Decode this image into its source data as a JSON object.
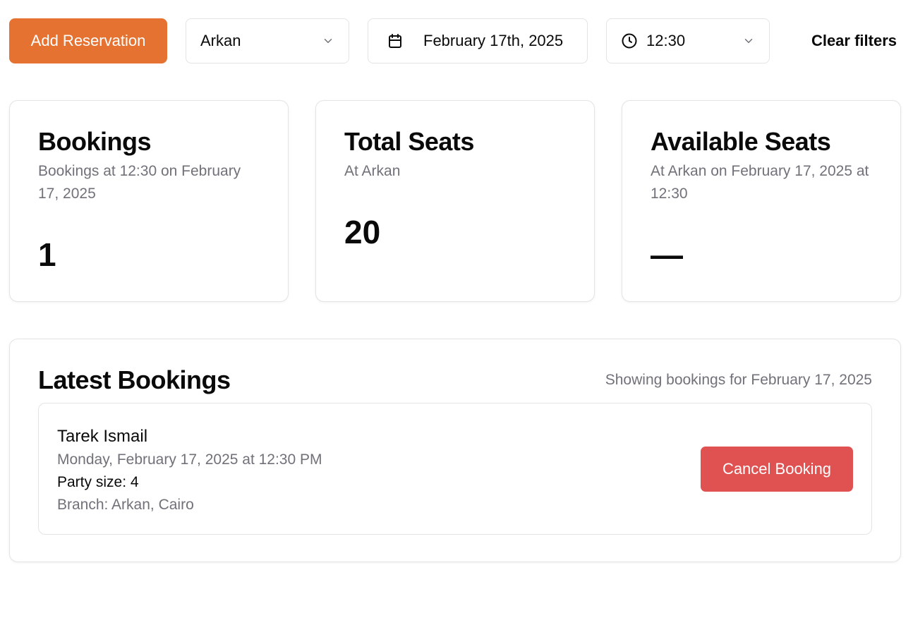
{
  "toolbar": {
    "add_reservation_label": "Add Reservation",
    "branch_value": "Arkan",
    "date_value": "February 17th, 2025",
    "time_value": "12:30",
    "clear_filters_label": "Clear filters"
  },
  "stats": {
    "bookings": {
      "title": "Bookings",
      "description": "Bookings at 12:30 on February 17, 2025",
      "value": "1"
    },
    "total_seats": {
      "title": "Total Seats",
      "description": "At Arkan",
      "value": "20"
    },
    "available_seats": {
      "title": "Available Seats",
      "description": "At Arkan on February 17, 2025 at 12:30",
      "value": "—"
    }
  },
  "latest": {
    "title": "Latest Bookings",
    "subtitle": "Showing bookings for February 17, 2025",
    "bookings": [
      {
        "name": "Tarek Ismail",
        "datetime": "Monday, February 17, 2025 at 12:30 PM",
        "party_size": "Party size: 4",
        "branch": "Branch: Arkan, Cairo",
        "cancel_label": "Cancel Booking"
      }
    ]
  },
  "colors": {
    "primary": "#e57231",
    "danger": "#e05252",
    "muted_text": "#71717a",
    "border": "#e4e4e7"
  },
  "icons": {
    "date_picker": "calendar-icon",
    "time_select": "clock-icon",
    "dropdown": "chevron-down-icon"
  }
}
